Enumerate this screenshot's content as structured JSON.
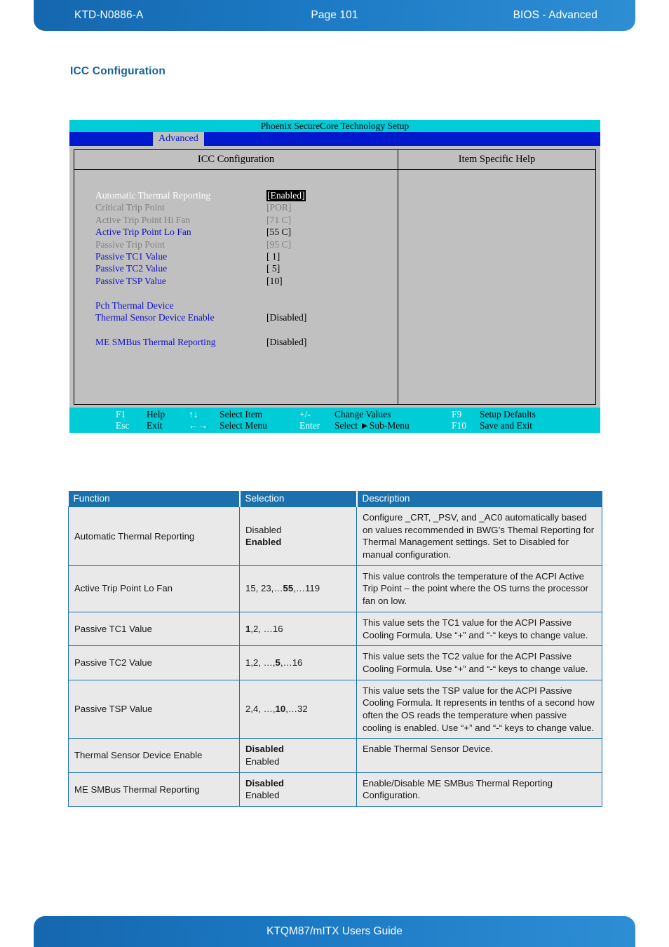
{
  "page_header": {
    "doc_id": "KTD-N0886-A",
    "page_label": "Page 101",
    "section_label": "BIOS  - Advanced"
  },
  "page_footer": {
    "guide_title": "KTQM87/mITX Users Guide"
  },
  "section": {
    "title": "ICC Configuration"
  },
  "bios": {
    "title_bar": "Phoenix SecureCore Technology Setup",
    "menu_tab": "Advanced",
    "pane_left_header": "ICC Configuration",
    "pane_right_header": "Item Specific Help",
    "options": [
      {
        "label": "Automatic Thermal Reporting",
        "value": "[Enabled]",
        "label_style": "white",
        "value_style": "inverted"
      },
      {
        "label": "Critical Trip Point",
        "value": "[POR]",
        "label_style": "gray",
        "value_style": "gray"
      },
      {
        "label": "Active Trip Point Hi Fan",
        "value": "[71 C]",
        "label_style": "gray",
        "value_style": "gray"
      },
      {
        "label": "Active Trip Point Lo Fan",
        "value": "[55 C]",
        "label_style": "blue",
        "value_style": "black"
      },
      {
        "label": "Passive Trip Point",
        "value": "[95 C]",
        "label_style": "gray",
        "value_style": "gray"
      },
      {
        "label": "Passive TC1 Value",
        "value": "[  1]",
        "label_style": "blue",
        "value_style": "black"
      },
      {
        "label": "Passive TC2 Value",
        "value": "[  5]",
        "label_style": "blue",
        "value_style": "black"
      },
      {
        "label": "Passive TSP Value",
        "value": "[10]",
        "label_style": "blue",
        "value_style": "black"
      },
      {
        "label": "",
        "value": "",
        "label_style": "blue",
        "value_style": "black"
      },
      {
        "label": "Pch Thermal Device",
        "value": "",
        "label_style": "blue",
        "value_style": "black"
      },
      {
        "label": "Thermal Sensor Device Enable",
        "value": "[Disabled]",
        "label_style": "blue",
        "value_style": "black"
      },
      {
        "label": "",
        "value": "",
        "label_style": "blue",
        "value_style": "black"
      },
      {
        "label": "ME SMBus Thermal Reporting",
        "value": "[Disabled]",
        "label_style": "blue",
        "value_style": "black"
      }
    ],
    "footer": {
      "row1": [
        {
          "key": "F1",
          "desc": "Help"
        },
        {
          "key": "↑↓",
          "desc": "Select Item"
        },
        {
          "key": "+/-",
          "desc": "Change Values"
        },
        {
          "key": "F9",
          "desc": "Setup Defaults"
        }
      ],
      "row2": [
        {
          "key": "Esc",
          "desc": "Exit"
        },
        {
          "key": "←→",
          "desc": "Select Menu"
        },
        {
          "key": "Enter",
          "desc": "Select ►Sub-Menu"
        },
        {
          "key": "F10",
          "desc": "Save and Exit"
        }
      ]
    }
  },
  "table": {
    "headers": [
      "Function",
      "Selection",
      "Description"
    ],
    "rows": [
      {
        "function": "Automatic Thermal Reporting",
        "selection_lines": [
          {
            "text": "Disabled",
            "bold": false
          },
          {
            "text": "Enabled",
            "bold": true
          }
        ],
        "description": "Configure _CRT, _PSV, and _AC0 automatically based on values recommended in BWG’s Themal Reporting for Thermal Management settings. Set to Disabled for manual configuration."
      },
      {
        "function": "Active Trip Point Lo Fan",
        "selection_rich": [
          {
            "text": "15, 23,…",
            "bold": false
          },
          {
            "text": "55",
            "bold": true
          },
          {
            "text": ",…119",
            "bold": false
          }
        ],
        "description": "This value controls the temperature of the ACPI Active Trip Point – the point where the OS turns the processor fan on low."
      },
      {
        "function": "Passive TC1 Value",
        "selection_rich": [
          {
            "text": "1",
            "bold": true
          },
          {
            "text": ",2, …16",
            "bold": false
          }
        ],
        "description": "This value sets the TC1 value for the ACPI Passive Cooling Formula. Use “+” and “-“ keys to change value."
      },
      {
        "function": "Passive TC2 Value",
        "selection_rich": [
          {
            "text": "1,2, …,",
            "bold": false
          },
          {
            "text": "5",
            "bold": true
          },
          {
            "text": ",…16",
            "bold": false
          }
        ],
        "description": "This value sets the TC2 value for the ACPI Passive Cooling Formula. Use “+” and “-“ keys to change value."
      },
      {
        "function": "Passive TSP Value",
        "selection_rich": [
          {
            "text": "2,4, …,",
            "bold": false
          },
          {
            "text": "10",
            "bold": true
          },
          {
            "text": ",…32",
            "bold": false
          }
        ],
        "description": "This value sets the TSP value for the ACPI Passive Cooling Formula. It represents in tenths of a second how often the OS reads the temperature when passive cooling is enabled. Use “+” and “-“ keys to change value."
      },
      {
        "function": "Thermal Sensor Device Enable",
        "selection_lines": [
          {
            "text": "Disabled",
            "bold": true
          },
          {
            "text": "Enabled",
            "bold": false
          }
        ],
        "description": "Enable Thermal Sensor Device."
      },
      {
        "function": "ME SMBus Thermal Reporting",
        "selection_lines": [
          {
            "text": "Disabled",
            "bold": true
          },
          {
            "text": "Enabled",
            "bold": false
          }
        ],
        "description": "Enable/Disable ME SMBus Thermal Reporting Configuration."
      }
    ]
  },
  "colors": {
    "brand_blue": "#1567ae",
    "table_header_blue": "#1b71ad",
    "heading_blue": "#15629f",
    "bios_cyan": "#00ccd8",
    "bios_menu_blue": "#0019cc",
    "bios_gray": "#c0c0c0"
  }
}
